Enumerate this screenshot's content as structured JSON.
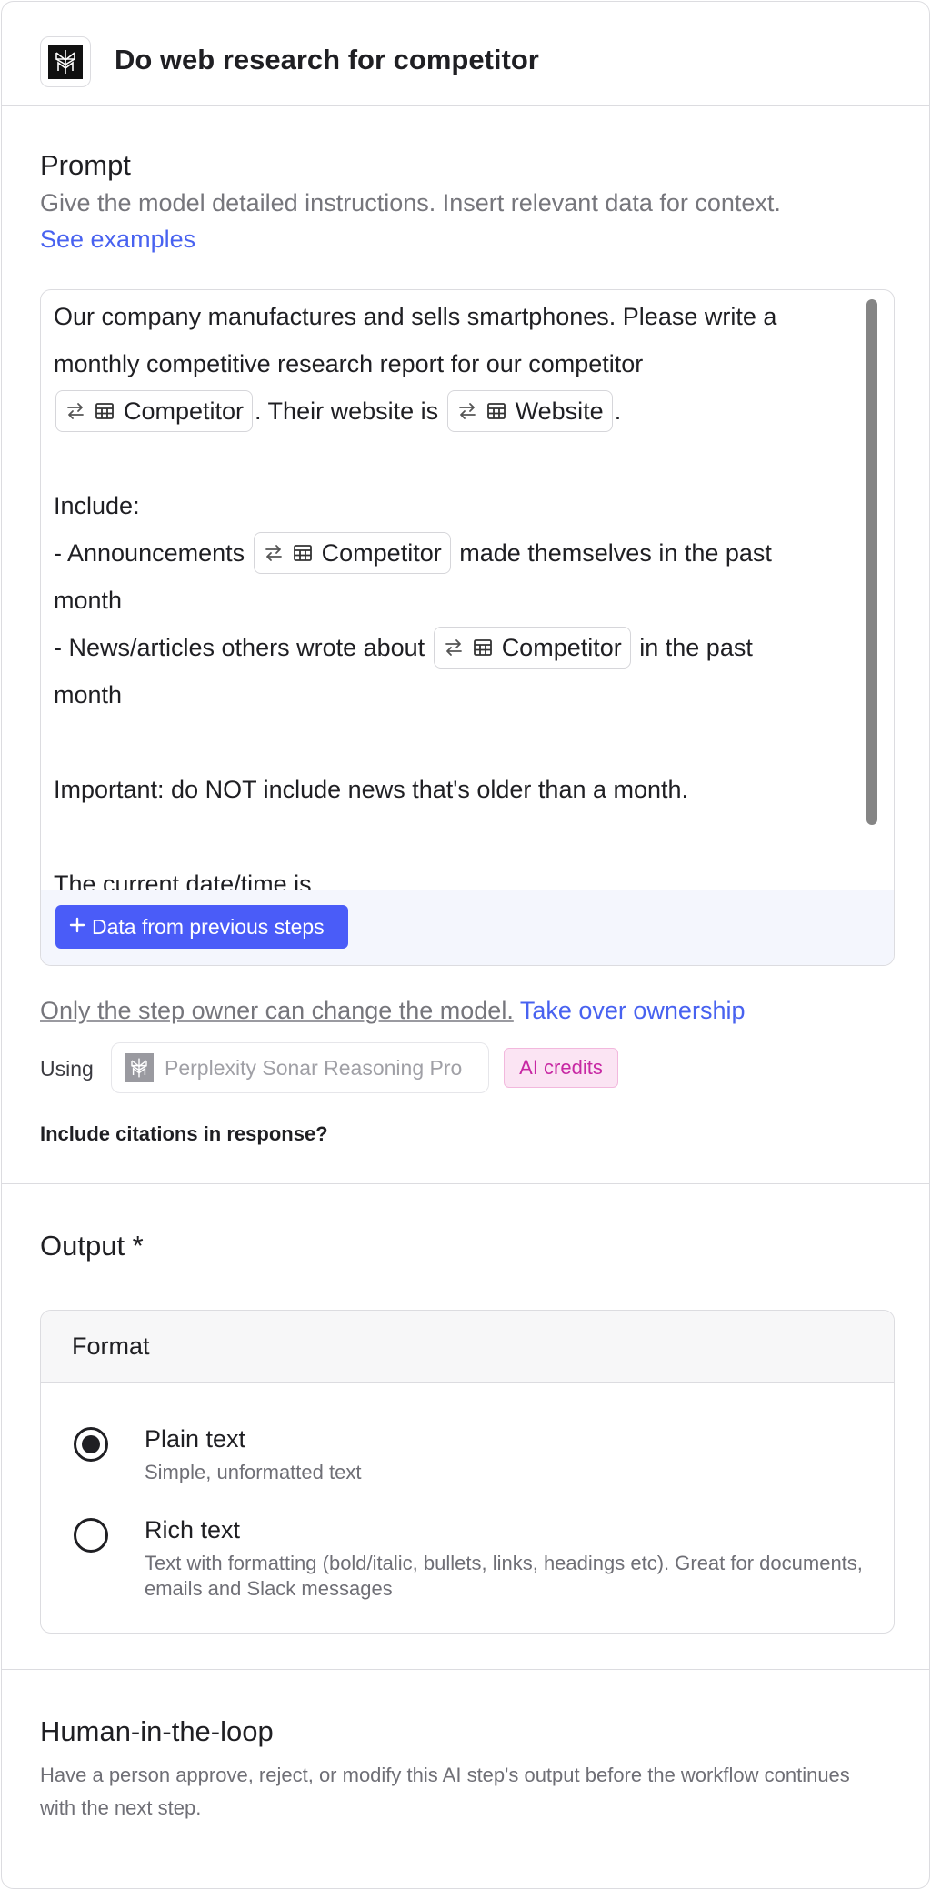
{
  "header": {
    "title": "Do web research for competitor",
    "logo_icon": "perplexity-logo-icon"
  },
  "prompt": {
    "title": "Prompt",
    "description": "Give the model detailed instructions. Insert relevant data for context.",
    "examples_link": "See examples",
    "text": {
      "l1": "Our company manufactures and sells smartphones. Please write a",
      "l2": "monthly competitive research report for our competitor",
      "l3_mid": ". Their website is",
      "l3_end": ".",
      "l5": "Include:",
      "l6_pre": "- Announcements",
      "l6_post": "made themselves in the past",
      "l7": "month",
      "l8_pre": "- News/articles others wrote about",
      "l8_post": "in the past",
      "l9": "month",
      "l11": "Important: do NOT include news that's older than a month.",
      "l13": "The current date/time is"
    },
    "chips": {
      "competitor": "Competitor",
      "website": "Website"
    },
    "data_button": "Data from previous steps"
  },
  "model": {
    "owner_note": "Only the step owner can change the model.",
    "take_over": "Take over ownership",
    "using_label": "Using",
    "model_name": "Perplexity Sonar Reasoning Pro",
    "credits_badge": "AI credits",
    "citations_label": "Include citations in response?"
  },
  "output": {
    "title": "Output *",
    "format_title": "Format",
    "options": [
      {
        "label": "Plain text",
        "description": "Simple, unformatted text",
        "selected": true
      },
      {
        "label": "Rich text",
        "description": "Text with formatting (bold/italic, bullets, links, headings etc). Great for documents, emails and Slack messages",
        "selected": false
      }
    ]
  },
  "hitl": {
    "title": "Human-in-the-loop",
    "description": "Have a person approve, reject, or modify this AI step's output before the workflow continues with the next step."
  },
  "colors": {
    "accent": "#4a5cf8",
    "link": "#4862f0",
    "credits_bg": "#fbe4f3",
    "credits_text": "#c728a3"
  }
}
